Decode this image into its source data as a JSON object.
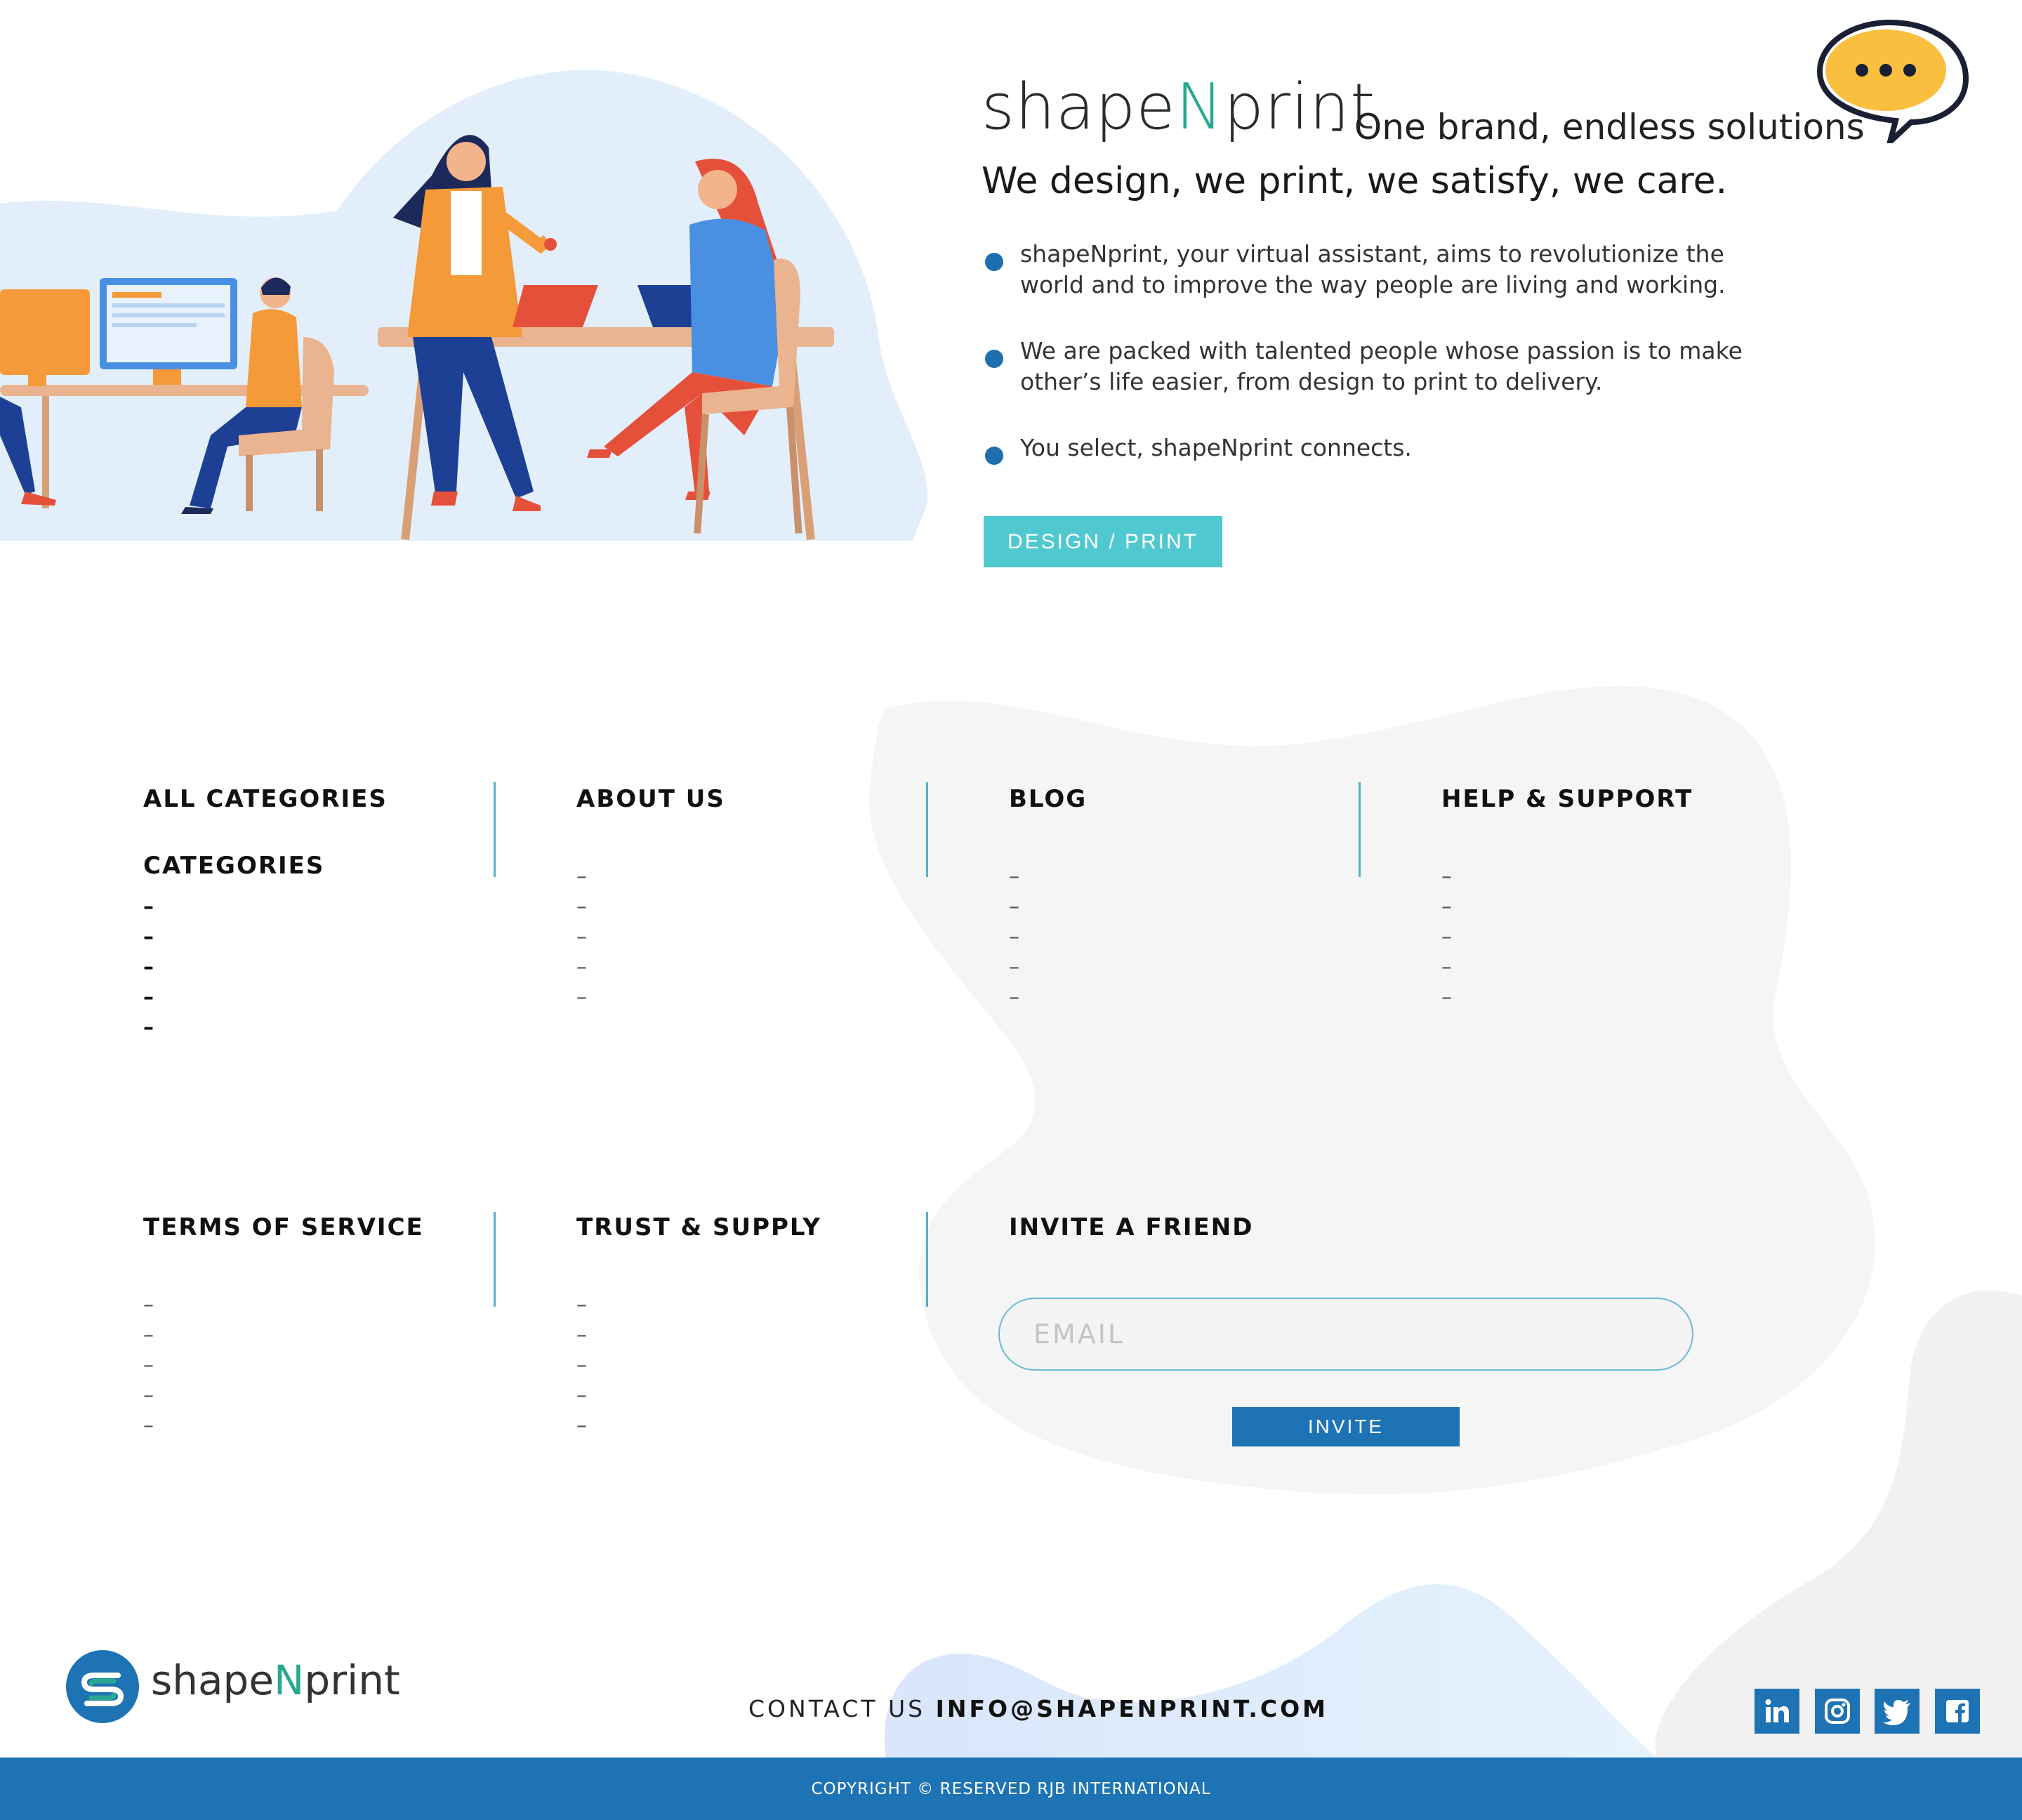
{
  "brand": {
    "name_prefix": "shape",
    "name_accent": "N",
    "name_suffix": "print",
    "tagline": "- One brand, endless solutions",
    "accent_color": "#2aa88f"
  },
  "hero": {
    "subtitle": "We design, we print, we satisfy, we care.",
    "bullets": [
      "shapeNprint, your virtual assistant, aims to revolutionize the world and to improve the way people are living and working.",
      "We are packed with talented people whose passion is to make other’s life easier, from design to print to delivery.",
      "You select, shapeNprint connects."
    ],
    "cta_label": "DESIGN / PRINT",
    "cta_color": "#4fc9cf",
    "chat_icon": "chat-bubble-icon"
  },
  "columns": {
    "all_categories": {
      "title": "ALL CATEGORIES",
      "subtitle": "CATEGORIES",
      "items": [
        "–",
        "–",
        "–",
        "–",
        "–"
      ]
    },
    "about_us": {
      "title": "ABOUT US",
      "items": [
        "–",
        "–",
        "–",
        "–",
        "–"
      ]
    },
    "blog": {
      "title": "BLOG",
      "items": [
        "–",
        "–",
        "–",
        "–",
        "–"
      ]
    },
    "help_support": {
      "title": "HELP & SUPPORT",
      "items": [
        "–",
        "–",
        "–",
        "–",
        "–"
      ]
    },
    "terms": {
      "title": "TERMS OF SERVICE",
      "items": [
        "–",
        "–",
        "–",
        "–",
        "–"
      ]
    },
    "trust_supply": {
      "title": "TRUST & SUPPLY",
      "items": [
        "–",
        "–",
        "–",
        "–",
        "–"
      ]
    },
    "invite": {
      "title": "INVITE A FRIEND",
      "email_placeholder": "EMAIL",
      "button_label": "INVITE"
    }
  },
  "footer": {
    "logo_prefix": "shape",
    "logo_accent": "N",
    "logo_suffix": "print",
    "contact_label": "CONTACT US",
    "contact_email": "INFO@SHAPENPRINT.COM",
    "social_icons": [
      "linkedin-icon",
      "instagram-icon",
      "twitter-icon",
      "facebook-icon"
    ],
    "copyright": "COPYRIGHT © RESERVED RJB INTERNATIONAL",
    "bar_color": "#1d73b3"
  }
}
